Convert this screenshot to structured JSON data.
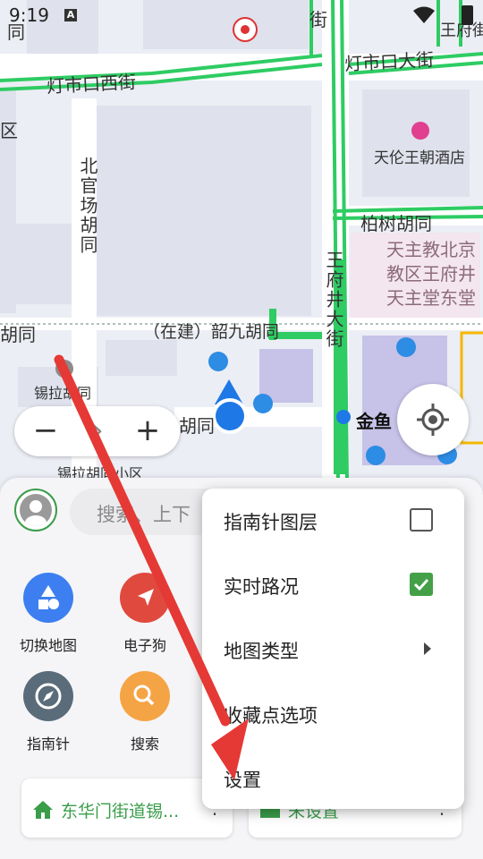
{
  "status_bar": {
    "time": "9:19",
    "notification_badge": "A"
  },
  "map_labels": {
    "dengshikou_west": "灯市口西街",
    "dengshikou_east": "灯市口大街",
    "hotel": "天伦王朝酒店",
    "baishu": "柏树胡同",
    "church": "天主教北京教区王府井天主堂东堂",
    "zhaojiu": "（在建）韶九胡同",
    "wangfujing": "王府井大街",
    "beiguanchang": "北官场胡同",
    "xila_hutong": "锡拉胡同",
    "xila_community": "锡拉胡同小区",
    "hutong_left": "胡同",
    "hutong_mid": "胡同",
    "metro_station": "金鱼",
    "qu": "区",
    "top_left_tong": "同",
    "top_jie": "街",
    "top_right": "王府街道"
  },
  "zoom": {
    "minus": "−",
    "forward": "›",
    "plus": "+"
  },
  "search": {
    "placeholder": "搜索、上下"
  },
  "quick_actions": [
    {
      "label": "切换地图",
      "icon": "shapes-icon",
      "color": "#3d7ff0"
    },
    {
      "label": "电子狗",
      "icon": "navigation-arrow-icon",
      "color": "#e04a3e"
    },
    {
      "label": "指南针",
      "icon": "compass-icon",
      "color": "#5a6b7a"
    },
    {
      "label": "搜索",
      "icon": "search-icon",
      "color": "#f5a445"
    }
  ],
  "cards": [
    {
      "label": "东华门街道锡...",
      "icon": "home-icon",
      "color": "#3a9d4a"
    },
    {
      "label": "未设置",
      "icon": "briefcase-icon",
      "color": "#3a9d4a"
    }
  ],
  "menu": {
    "items": [
      {
        "label": "指南针图层",
        "checked": false
      },
      {
        "label": "实时路况",
        "checked": true
      },
      {
        "label": "地图类型"
      },
      {
        "label": "收藏点选项"
      },
      {
        "label": "设置"
      }
    ]
  },
  "colors": {
    "road_green": "#2ecc63",
    "accent_green": "#43a047",
    "annotation_arrow": "#e53935",
    "location_blue": "#1e78e6"
  }
}
